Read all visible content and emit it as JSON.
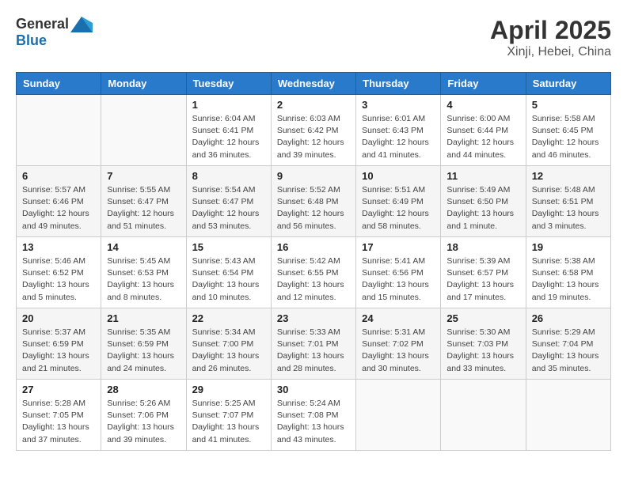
{
  "header": {
    "logo_general": "General",
    "logo_blue": "Blue",
    "month": "April 2025",
    "location": "Xinji, Hebei, China"
  },
  "days_of_week": [
    "Sunday",
    "Monday",
    "Tuesday",
    "Wednesday",
    "Thursday",
    "Friday",
    "Saturday"
  ],
  "weeks": [
    [
      {
        "day": "",
        "info": ""
      },
      {
        "day": "",
        "info": ""
      },
      {
        "day": "1",
        "info": "Sunrise: 6:04 AM\nSunset: 6:41 PM\nDaylight: 12 hours and 36 minutes."
      },
      {
        "day": "2",
        "info": "Sunrise: 6:03 AM\nSunset: 6:42 PM\nDaylight: 12 hours and 39 minutes."
      },
      {
        "day": "3",
        "info": "Sunrise: 6:01 AM\nSunset: 6:43 PM\nDaylight: 12 hours and 41 minutes."
      },
      {
        "day": "4",
        "info": "Sunrise: 6:00 AM\nSunset: 6:44 PM\nDaylight: 12 hours and 44 minutes."
      },
      {
        "day": "5",
        "info": "Sunrise: 5:58 AM\nSunset: 6:45 PM\nDaylight: 12 hours and 46 minutes."
      }
    ],
    [
      {
        "day": "6",
        "info": "Sunrise: 5:57 AM\nSunset: 6:46 PM\nDaylight: 12 hours and 49 minutes."
      },
      {
        "day": "7",
        "info": "Sunrise: 5:55 AM\nSunset: 6:47 PM\nDaylight: 12 hours and 51 minutes."
      },
      {
        "day": "8",
        "info": "Sunrise: 5:54 AM\nSunset: 6:47 PM\nDaylight: 12 hours and 53 minutes."
      },
      {
        "day": "9",
        "info": "Sunrise: 5:52 AM\nSunset: 6:48 PM\nDaylight: 12 hours and 56 minutes."
      },
      {
        "day": "10",
        "info": "Sunrise: 5:51 AM\nSunset: 6:49 PM\nDaylight: 12 hours and 58 minutes."
      },
      {
        "day": "11",
        "info": "Sunrise: 5:49 AM\nSunset: 6:50 PM\nDaylight: 13 hours and 1 minute."
      },
      {
        "day": "12",
        "info": "Sunrise: 5:48 AM\nSunset: 6:51 PM\nDaylight: 13 hours and 3 minutes."
      }
    ],
    [
      {
        "day": "13",
        "info": "Sunrise: 5:46 AM\nSunset: 6:52 PM\nDaylight: 13 hours and 5 minutes."
      },
      {
        "day": "14",
        "info": "Sunrise: 5:45 AM\nSunset: 6:53 PM\nDaylight: 13 hours and 8 minutes."
      },
      {
        "day": "15",
        "info": "Sunrise: 5:43 AM\nSunset: 6:54 PM\nDaylight: 13 hours and 10 minutes."
      },
      {
        "day": "16",
        "info": "Sunrise: 5:42 AM\nSunset: 6:55 PM\nDaylight: 13 hours and 12 minutes."
      },
      {
        "day": "17",
        "info": "Sunrise: 5:41 AM\nSunset: 6:56 PM\nDaylight: 13 hours and 15 minutes."
      },
      {
        "day": "18",
        "info": "Sunrise: 5:39 AM\nSunset: 6:57 PM\nDaylight: 13 hours and 17 minutes."
      },
      {
        "day": "19",
        "info": "Sunrise: 5:38 AM\nSunset: 6:58 PM\nDaylight: 13 hours and 19 minutes."
      }
    ],
    [
      {
        "day": "20",
        "info": "Sunrise: 5:37 AM\nSunset: 6:59 PM\nDaylight: 13 hours and 21 minutes."
      },
      {
        "day": "21",
        "info": "Sunrise: 5:35 AM\nSunset: 6:59 PM\nDaylight: 13 hours and 24 minutes."
      },
      {
        "day": "22",
        "info": "Sunrise: 5:34 AM\nSunset: 7:00 PM\nDaylight: 13 hours and 26 minutes."
      },
      {
        "day": "23",
        "info": "Sunrise: 5:33 AM\nSunset: 7:01 PM\nDaylight: 13 hours and 28 minutes."
      },
      {
        "day": "24",
        "info": "Sunrise: 5:31 AM\nSunset: 7:02 PM\nDaylight: 13 hours and 30 minutes."
      },
      {
        "day": "25",
        "info": "Sunrise: 5:30 AM\nSunset: 7:03 PM\nDaylight: 13 hours and 33 minutes."
      },
      {
        "day": "26",
        "info": "Sunrise: 5:29 AM\nSunset: 7:04 PM\nDaylight: 13 hours and 35 minutes."
      }
    ],
    [
      {
        "day": "27",
        "info": "Sunrise: 5:28 AM\nSunset: 7:05 PM\nDaylight: 13 hours and 37 minutes."
      },
      {
        "day": "28",
        "info": "Sunrise: 5:26 AM\nSunset: 7:06 PM\nDaylight: 13 hours and 39 minutes."
      },
      {
        "day": "29",
        "info": "Sunrise: 5:25 AM\nSunset: 7:07 PM\nDaylight: 13 hours and 41 minutes."
      },
      {
        "day": "30",
        "info": "Sunrise: 5:24 AM\nSunset: 7:08 PM\nDaylight: 13 hours and 43 minutes."
      },
      {
        "day": "",
        "info": ""
      },
      {
        "day": "",
        "info": ""
      },
      {
        "day": "",
        "info": ""
      }
    ]
  ]
}
